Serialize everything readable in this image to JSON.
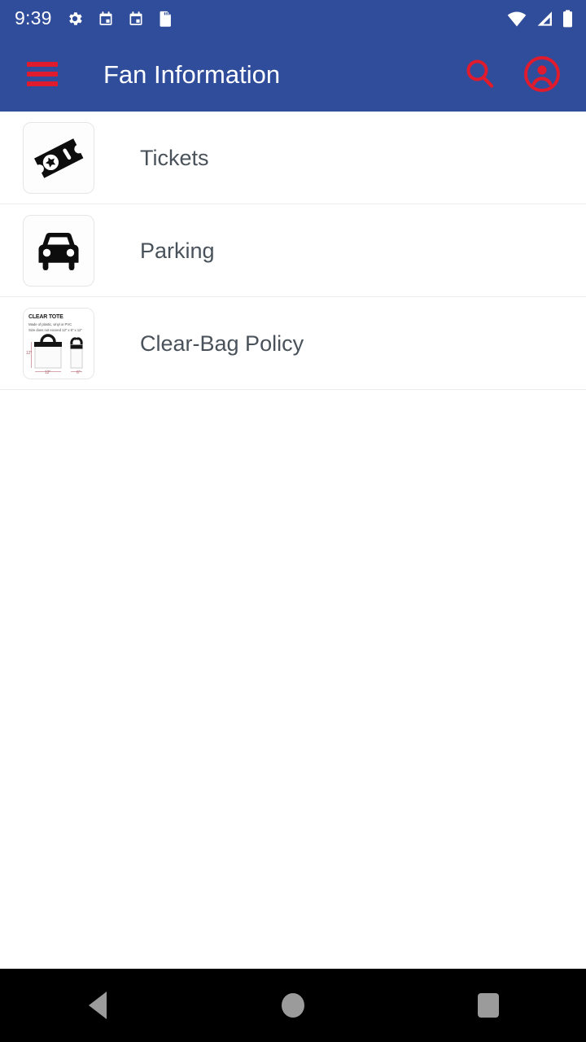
{
  "status_bar": {
    "clock": "9:39",
    "left_icons": [
      "gear-icon",
      "calendar-icon",
      "calendar-icon",
      "sd-card-icon"
    ],
    "right_icons": [
      "wifi-icon",
      "cell-signal-icon",
      "battery-icon"
    ],
    "background_color": "#2f4d9b"
  },
  "app_bar": {
    "title": "Fan Information",
    "menu_icon": "hamburger-menu-icon",
    "search_icon": "search-icon",
    "account_icon": "account-circle-icon",
    "accent_color": "#e01b2d",
    "background_color": "#2f4d9b",
    "title_color": "#ffffff"
  },
  "list": {
    "rows": [
      {
        "label": "Tickets",
        "icon": "ticket-icon"
      },
      {
        "label": "Parking",
        "icon": "car-icon"
      },
      {
        "label": "Clear-Bag Policy",
        "icon": "clear-tote-image"
      }
    ],
    "label_color": "#49525a"
  },
  "clear_tote_thumb": {
    "title": "CLEAR TOTE",
    "line1": "Made of plastic, vinyl or PVC",
    "line2": "Size does not exceed 12\" x 6\" x 12\"",
    "dim_height": "12\"",
    "dim_width": "12\"",
    "dim_depth": "6\""
  },
  "nav_bar": {
    "back": "back-nav-icon",
    "home": "home-nav-icon",
    "recents": "recents-nav-icon",
    "background_color": "#000000"
  }
}
